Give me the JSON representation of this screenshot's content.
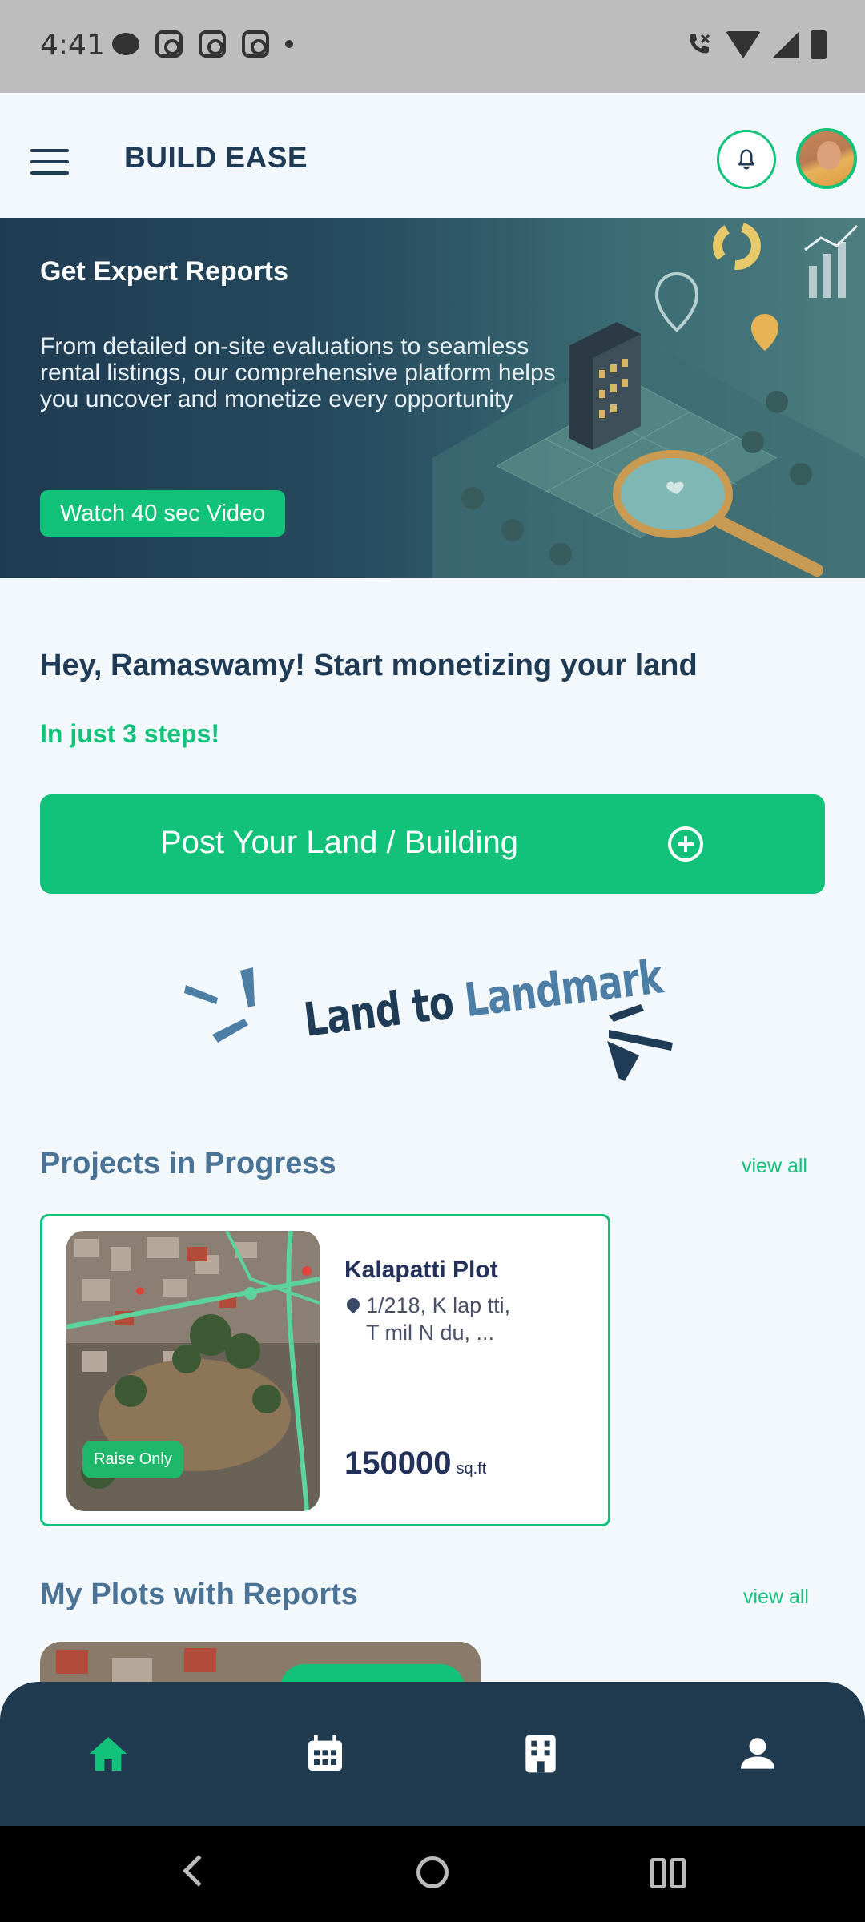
{
  "status_bar": {
    "time": "4:41"
  },
  "header": {
    "title": "BUILD EASE"
  },
  "hero": {
    "title": "Get Expert Reports",
    "description": "From detailed on-site evaluations to seamless rental listings, our comprehensive platform helps you uncover and monetize every opportunity",
    "video_button": "Watch 40 sec Video"
  },
  "greeting": {
    "title": "Hey, Ramaswamy!  Start monetizing your land",
    "subtitle": "In just 3 steps!"
  },
  "post_button": {
    "label": "Post Your Land / Building"
  },
  "tagline": {
    "part1": "Land to",
    "part2": "Landmark"
  },
  "projects": {
    "title": "Projects in Progress",
    "view_all": "view all",
    "items": [
      {
        "name": "Kalapatti Plot",
        "address_line1": "1/218, K  lap  tti,",
        "address_line2": "T  mil N  du, ...",
        "size": "150000",
        "unit": "sq.ft",
        "badge": "Raise Only"
      }
    ]
  },
  "reports": {
    "title": "My Plots with Reports",
    "view_all": "view all"
  },
  "bottom_nav": [
    "home",
    "calendar",
    "buildings",
    "profile"
  ],
  "colors": {
    "accent": "#12c27a",
    "primary": "#1f3b55",
    "nav_bg": "#203b50"
  }
}
